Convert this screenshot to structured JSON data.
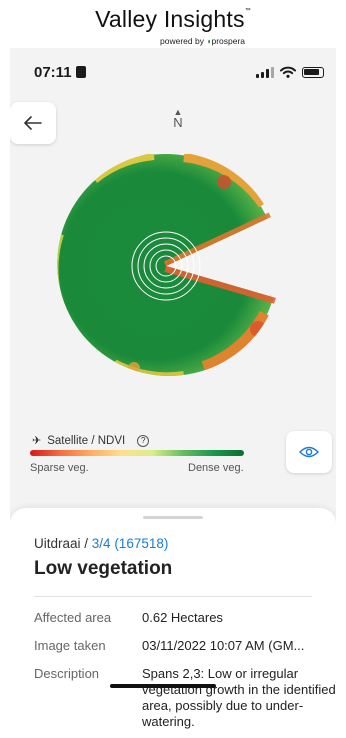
{
  "brand": {
    "title": "Valley Insights",
    "trademark": "™",
    "powered_by": "powered by",
    "partner": "prospera"
  },
  "status_bar": {
    "time": "07:11"
  },
  "map": {
    "north_label": "N",
    "layer_label": "Satellite / NDVI",
    "legend_low": "Sparse veg.",
    "legend_high": "Dense veg."
  },
  "details": {
    "breadcrumb_field": "Uitdraai /",
    "breadcrumb_link": "3/4 (167518)",
    "title": "Low vegetation",
    "rows": [
      {
        "label": "Affected area",
        "value": "0.62 Hectares"
      },
      {
        "label": "Image taken",
        "value": "03/11/2022 10:07 AM (GM..."
      },
      {
        "label": "Description",
        "value": "Spans 2,3: Low or irregular vegetation growth in the identified area, possibly due to under-watering."
      }
    ]
  },
  "colors": {
    "accent_blue": "#1e7bd8",
    "dense_green": "#1a8a3a",
    "sparse_red": "#d7191c"
  }
}
